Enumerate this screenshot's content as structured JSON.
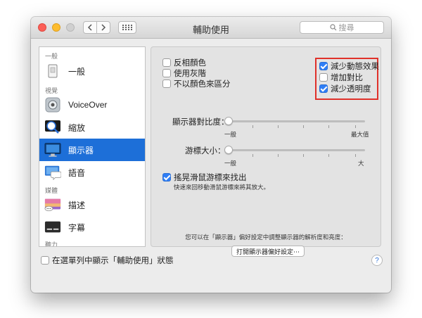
{
  "window": {
    "title": "輔助使用"
  },
  "search": {
    "placeholder": "搜尋"
  },
  "sidebar": {
    "sections": {
      "general": "一般",
      "vision": "視覺",
      "media": "媒體",
      "hearing": "聽力"
    },
    "items": [
      {
        "label": "一般",
        "icon": "general-icon"
      },
      {
        "label": "VoiceOver",
        "icon": "voiceover-icon"
      },
      {
        "label": "縮放",
        "icon": "zoom-icon"
      },
      {
        "label": "顯示器",
        "icon": "display-icon",
        "selected": true
      },
      {
        "label": "語音",
        "icon": "speech-icon"
      },
      {
        "label": "描述",
        "icon": "descriptions-icon"
      },
      {
        "label": "字幕",
        "icon": "captions-icon"
      }
    ]
  },
  "display": {
    "options_left": [
      {
        "label": "反相顏色",
        "checked": false
      },
      {
        "label": "使用灰階",
        "checked": false
      },
      {
        "label": "不以顏色來區分",
        "checked": false
      }
    ],
    "options_right": [
      {
        "label": "減少動態效果",
        "checked": true
      },
      {
        "label": "增加對比",
        "checked": false
      },
      {
        "label": "減少透明度",
        "checked": true
      }
    ],
    "contrast": {
      "label": "顯示器對比度：",
      "min_label": "一般",
      "max_label": "最大值",
      "value": 0
    },
    "cursor": {
      "label": "游標大小：",
      "min_label": "一般",
      "max_label": "大",
      "value": 0
    },
    "shake": {
      "label": "搖晃滑鼠游標來找出",
      "checked": true,
      "sub": "快速來回移動滑鼠游標來將其放大。"
    },
    "note": "您可以在「顯示器」偏好設定中調整顯示器的解析度和亮度：",
    "open_button": "打開顯示器偏好設定⋯"
  },
  "footer": {
    "menubar_label": "在選單列中顯示「輔助使用」狀態",
    "menubar_checked": false,
    "help": "?"
  },
  "colors": {
    "accent": "#1d6fd8",
    "highlight": "#e0312a"
  }
}
